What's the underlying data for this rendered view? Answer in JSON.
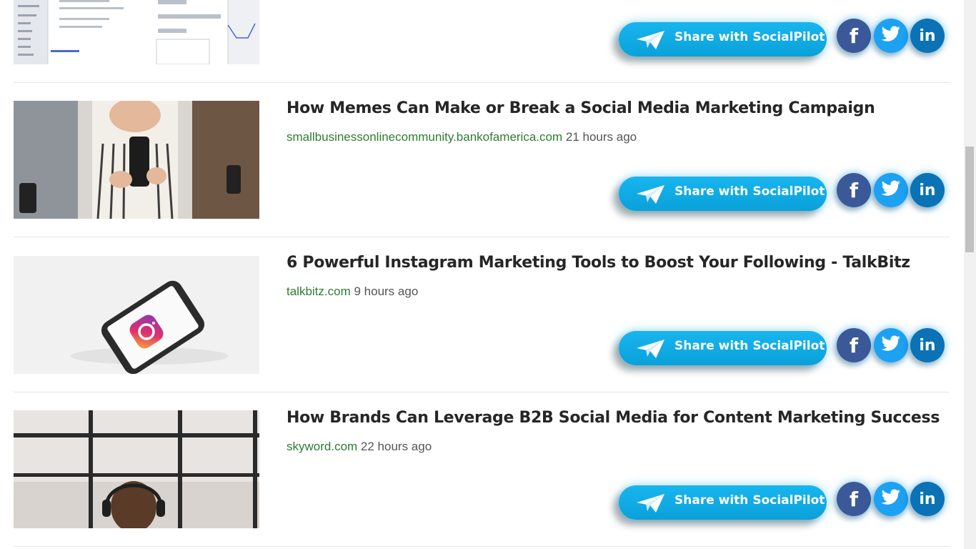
{
  "share_label": "Share with SocialPilot",
  "icons": {
    "share": "paper-plane-icon",
    "facebook": "facebook-icon",
    "twitter": "twitter-icon",
    "linkedin": "linkedin-icon"
  },
  "social": {
    "facebook_glyph": "f",
    "linkedin_glyph": "in"
  },
  "colors": {
    "share_button": "#0aa1da",
    "facebook": "#3b5998",
    "twitter": "#1da1f2",
    "linkedin": "#0a72b5",
    "source_link": "#2e7d32"
  },
  "articles": [
    {
      "title": "How Memes Can Make or Break a Social Media Marketing Campaign",
      "source": "smallbusinessonlinecommunity.bankofamerica.com",
      "time": "21 hours ago"
    },
    {
      "title": "6 Powerful Instagram Marketing Tools to Boost Your Following - TalkBitz",
      "source": "talkbitz.com",
      "time": "9 hours ago"
    },
    {
      "title": "How Brands Can Leverage B2B Social Media for Content Marketing Success",
      "source": "skyword.com",
      "time": "22 hours ago"
    }
  ]
}
